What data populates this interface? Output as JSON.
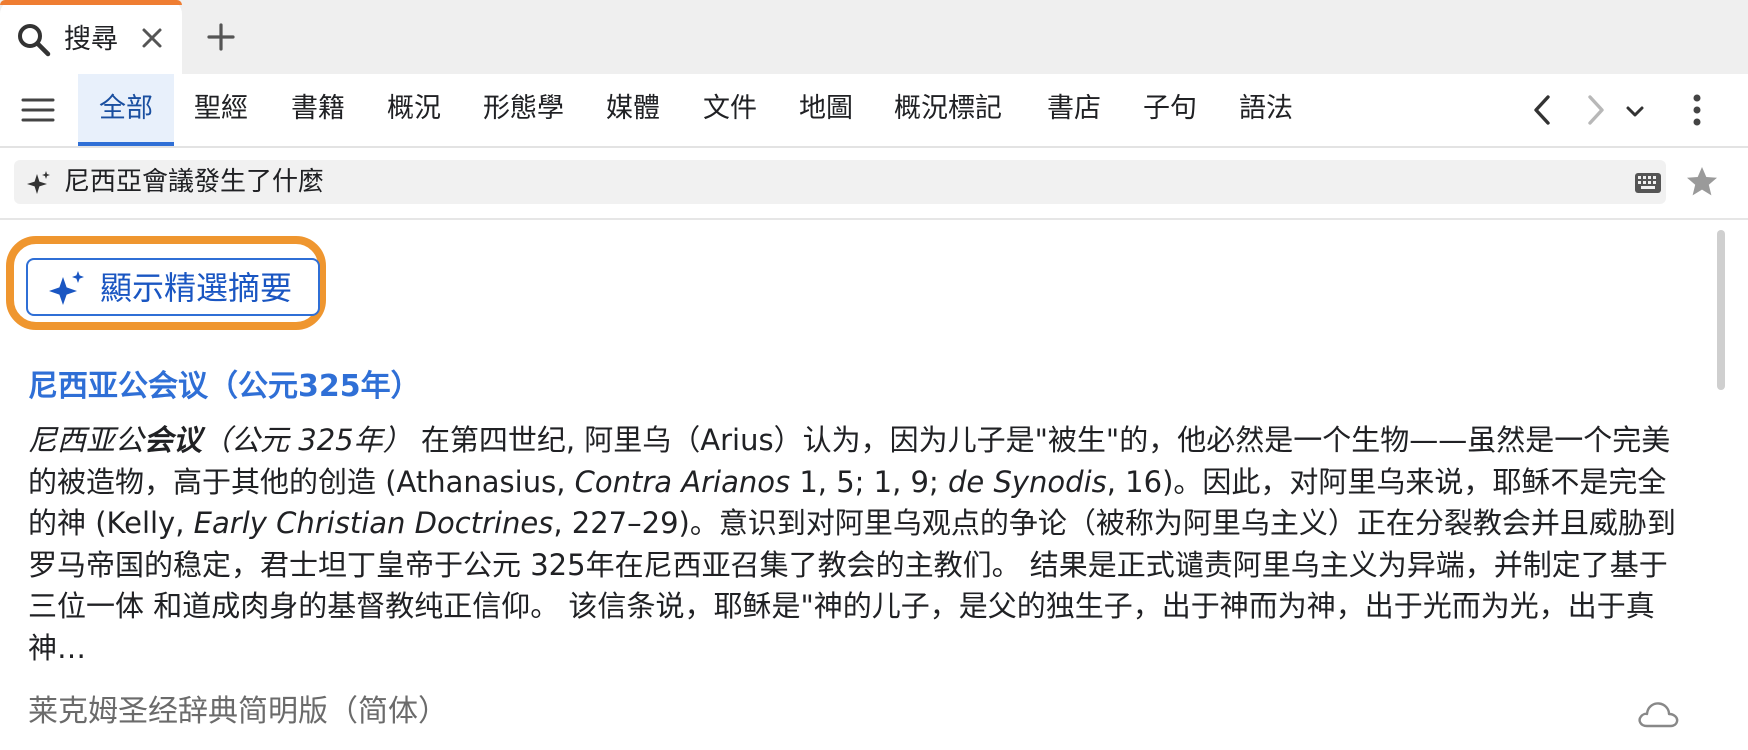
{
  "tab": {
    "label": "搜尋",
    "search_icon": "search-icon",
    "close_icon": "close-icon",
    "new_tab_icon": "plus-icon",
    "accent_color": "#ef7d32"
  },
  "categories": {
    "active_index": 0,
    "items": [
      "全部",
      "聖經",
      "書籍",
      "概況",
      "形態學",
      "媒體",
      "文件",
      "地圖",
      "概況標記",
      "書店",
      "子句",
      "語法"
    ],
    "icons": {
      "menu": "hamburger-menu-icon",
      "prev": "chevron-left-icon",
      "next": "chevron-right-icon",
      "more": "chevron-down-icon",
      "overflow": "vertical-dots-icon"
    }
  },
  "query": {
    "text": "尼西亞會議發生了什麼",
    "icons": {
      "ai": "sparkle-icon",
      "keyboard": "keyboard-icon",
      "favorite": "star-icon"
    }
  },
  "summary_button": {
    "label": "顯示精選摘要",
    "icon": "sparkle-icon",
    "highlight_color": "#ef962f",
    "accent_color": "#2f6fd6"
  },
  "result": {
    "title": "尼西亚公会议（公元325年）",
    "snippet": {
      "lead_a": "尼西亚公",
      "lead_b": "会议",
      "lead_c": "（公元 325年）",
      "part1": " 在第四世纪, 阿里乌（Arius）认为，因为儿子是\"被生\"的，他必然是一个生物——虽然是一个完美的被造物，高于其他的创造 (Athanasius, ",
      "cite1": "Contra Arianos",
      "part2": " 1, 5; 1, 9; ",
      "cite2": "de Synodis",
      "part3": ", 16)。因此，对阿里乌来说，耶稣不是完全的神 (Kelly, ",
      "cite3": "Early Christian Doctrines",
      "part4": ", 227–29)。意识到对阿里乌观点的争论（被称为阿里乌主义）正在分裂教会并且威胁到 罗马帝国的稳定，君士坦丁皇帝于公元 325年在尼西亚召集了教会的主教们。 结果是正式谴责阿里乌主义为异端，并制定了基于 三位一体 和道成肉身的基督教纯正信仰。 该信条说，耶稣是\"神的儿子，是父的独生子，出于神而为神，出于光而为光，出于真神…"
    },
    "source": "莱克姆圣经辞典简明版（简体）",
    "source_icon": "cloud-icon"
  }
}
